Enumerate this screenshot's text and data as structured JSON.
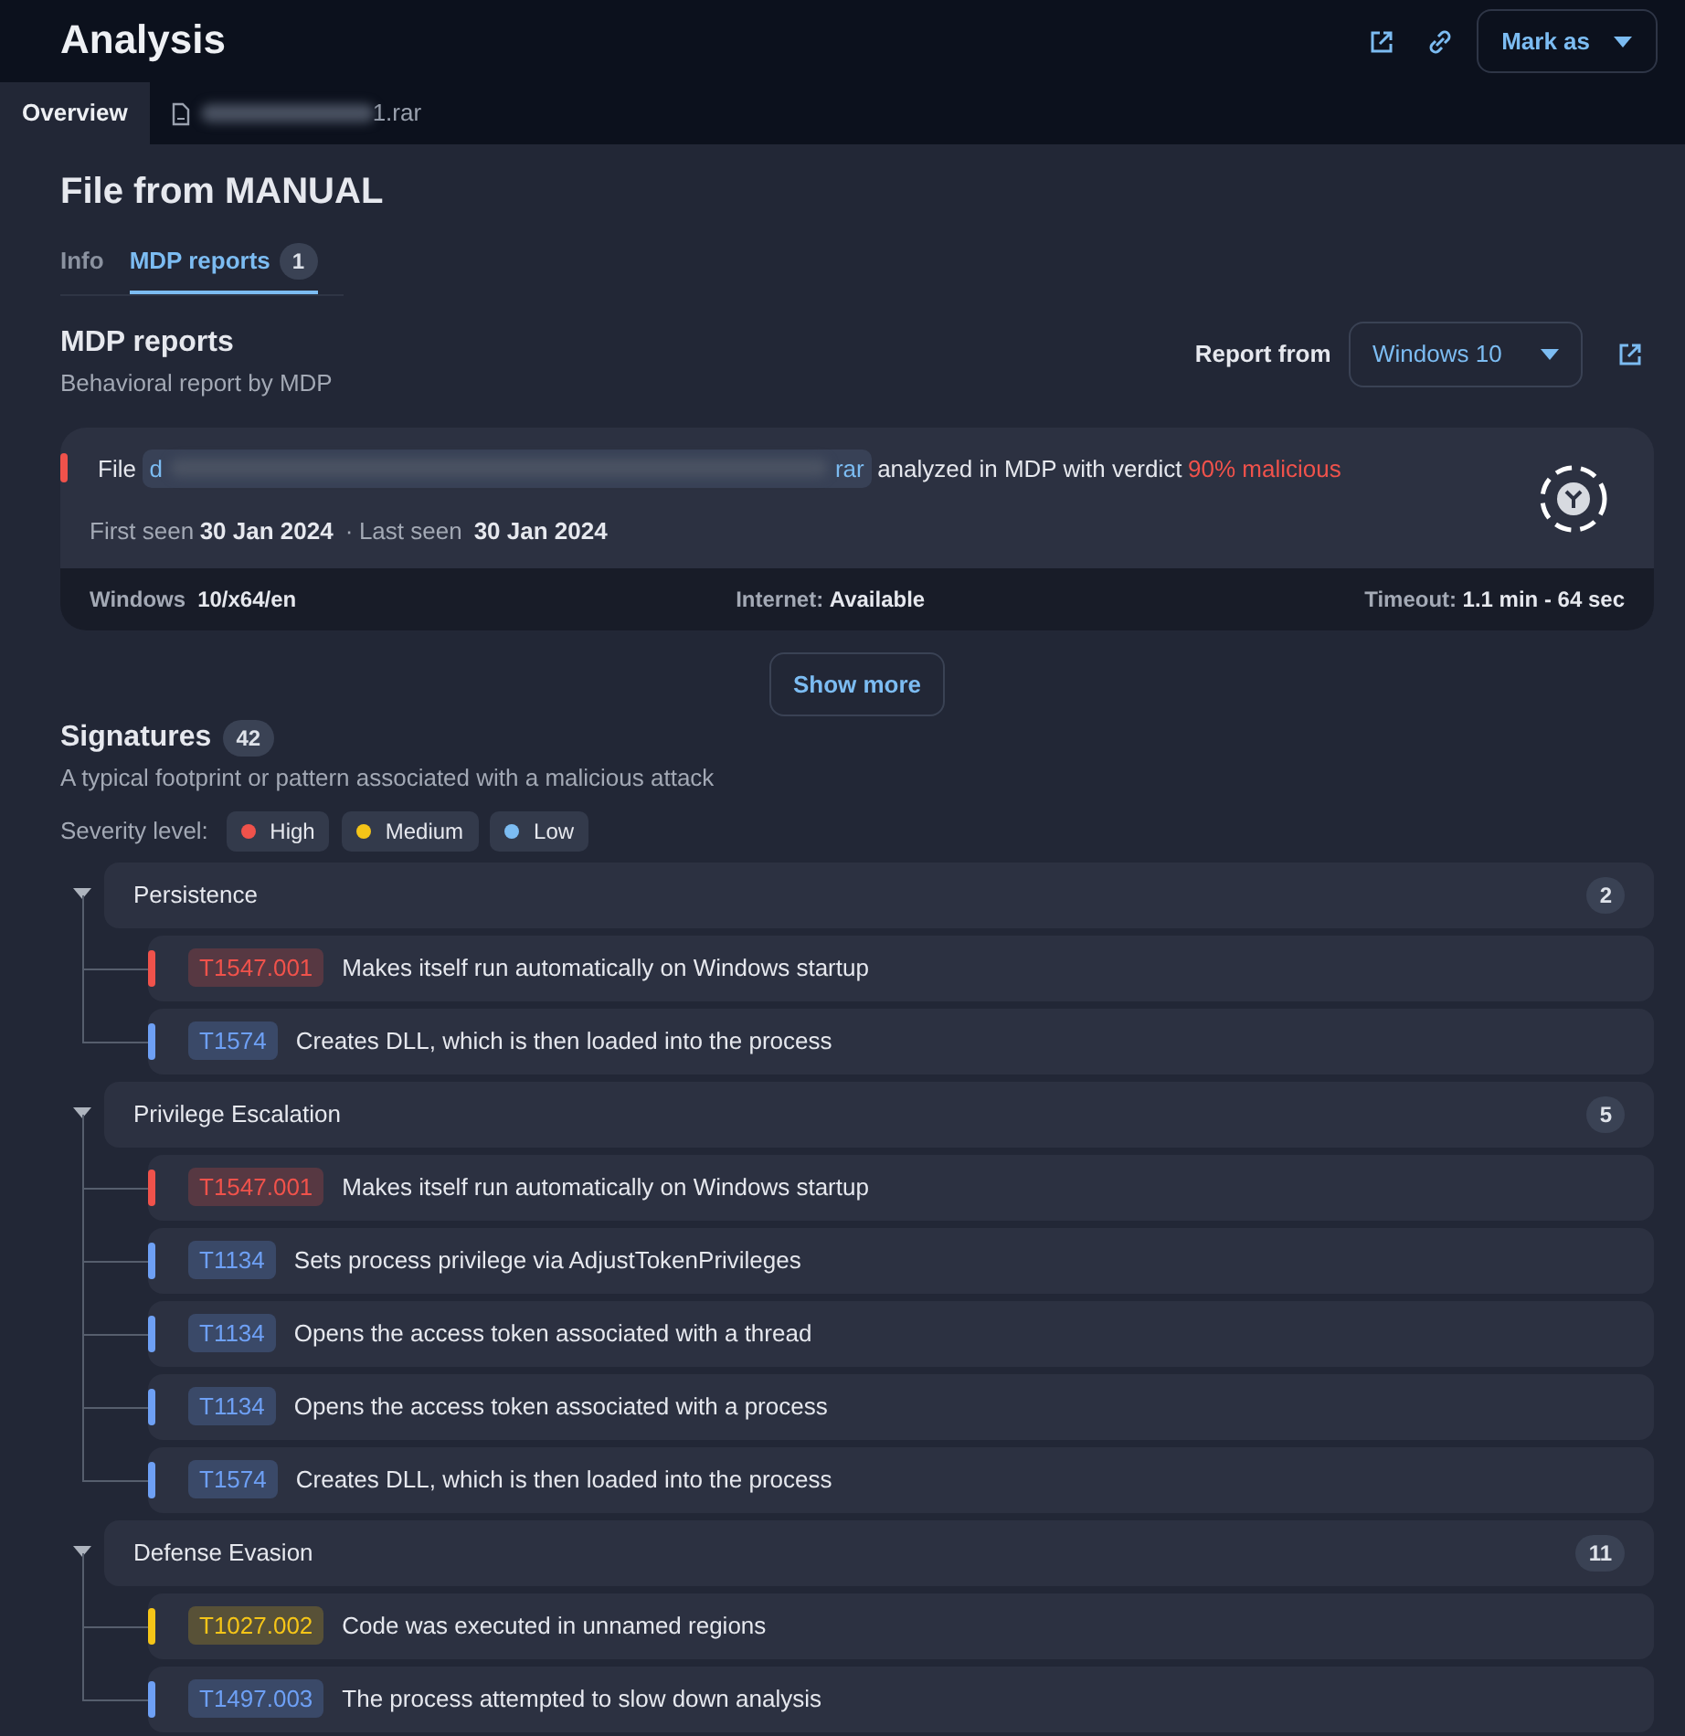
{
  "header": {
    "title": "Analysis",
    "mark_button": "Mark as"
  },
  "page_tabs": [
    {
      "label": "Overview",
      "selected": true,
      "kind": "text"
    },
    {
      "label": "1.rar",
      "selected": false,
      "kind": "file"
    }
  ],
  "file_title": "File from MANUAL",
  "sub_tabs": [
    {
      "label": "Info",
      "selected": false
    },
    {
      "label": "MDP reports",
      "count": "1",
      "selected": true
    }
  ],
  "report": {
    "title": "MDP reports",
    "subtitle": "Behavioral report by MDP",
    "report_from_label": "Report from",
    "report_from_value": "Windows 10",
    "file_label": "File",
    "file_name_start": "d",
    "file_name_end": "rar",
    "analyzed_text": "analyzed in MDP with verdict",
    "verdict": "90% malicious",
    "first_seen_label": "First seen",
    "first_seen": "30 Jan 2024",
    "separator": "·",
    "last_seen_label": "Last seen",
    "last_seen": "30 Jan 2024",
    "os_label": "Windows",
    "os_value": "10/x64/en",
    "internet_label": "Internet:",
    "internet_value": "Available",
    "timeout_label": "Timeout:",
    "timeout_value": "1.1 min - 64 sec"
  },
  "show_more": "Show more",
  "signatures": {
    "title": "Signatures",
    "count": "42",
    "subtitle": "A typical footprint or pattern associated with a malicious attack",
    "severity_label": "Severity level:",
    "legend": [
      {
        "label": "High",
        "color": "#f0524b"
      },
      {
        "label": "Medium",
        "color": "#f5c518"
      },
      {
        "label": "Low",
        "color": "#7cbcf2"
      }
    ],
    "groups": [
      {
        "name": "Persistence",
        "count": "2",
        "expanded": true,
        "children": [
          {
            "code": "T1547.001",
            "text": "Makes itself run automatically on Windows startup",
            "color": "#f0524b"
          },
          {
            "code": "T1574",
            "text": "Creates DLL, which is then loaded into the process",
            "color": "#6ea0f5"
          }
        ]
      },
      {
        "name": "Privilege Escalation",
        "count": "5",
        "expanded": true,
        "children": [
          {
            "code": "T1547.001",
            "text": "Makes itself run automatically on Windows startup",
            "color": "#f0524b"
          },
          {
            "code": "T1134",
            "text": "Sets process privilege via AdjustTokenPrivileges",
            "color": "#6ea0f5"
          },
          {
            "code": "T1134",
            "text": "Opens the access token associated with a thread",
            "color": "#6ea0f5"
          },
          {
            "code": "T1134",
            "text": "Opens the access token associated with a process",
            "color": "#6ea0f5"
          },
          {
            "code": "T1574",
            "text": "Creates DLL, which is then loaded into the process",
            "color": "#6ea0f5"
          }
        ]
      },
      {
        "name": "Defense Evasion",
        "count": "11",
        "expanded": true,
        "children": [
          {
            "code": "T1027.002",
            "text": "Code was executed in unnamed regions",
            "color": "#f5c518"
          },
          {
            "code": "T1497.003",
            "text": "The process attempted to slow down analysis",
            "color": "#6ea0f5"
          }
        ]
      }
    ]
  }
}
